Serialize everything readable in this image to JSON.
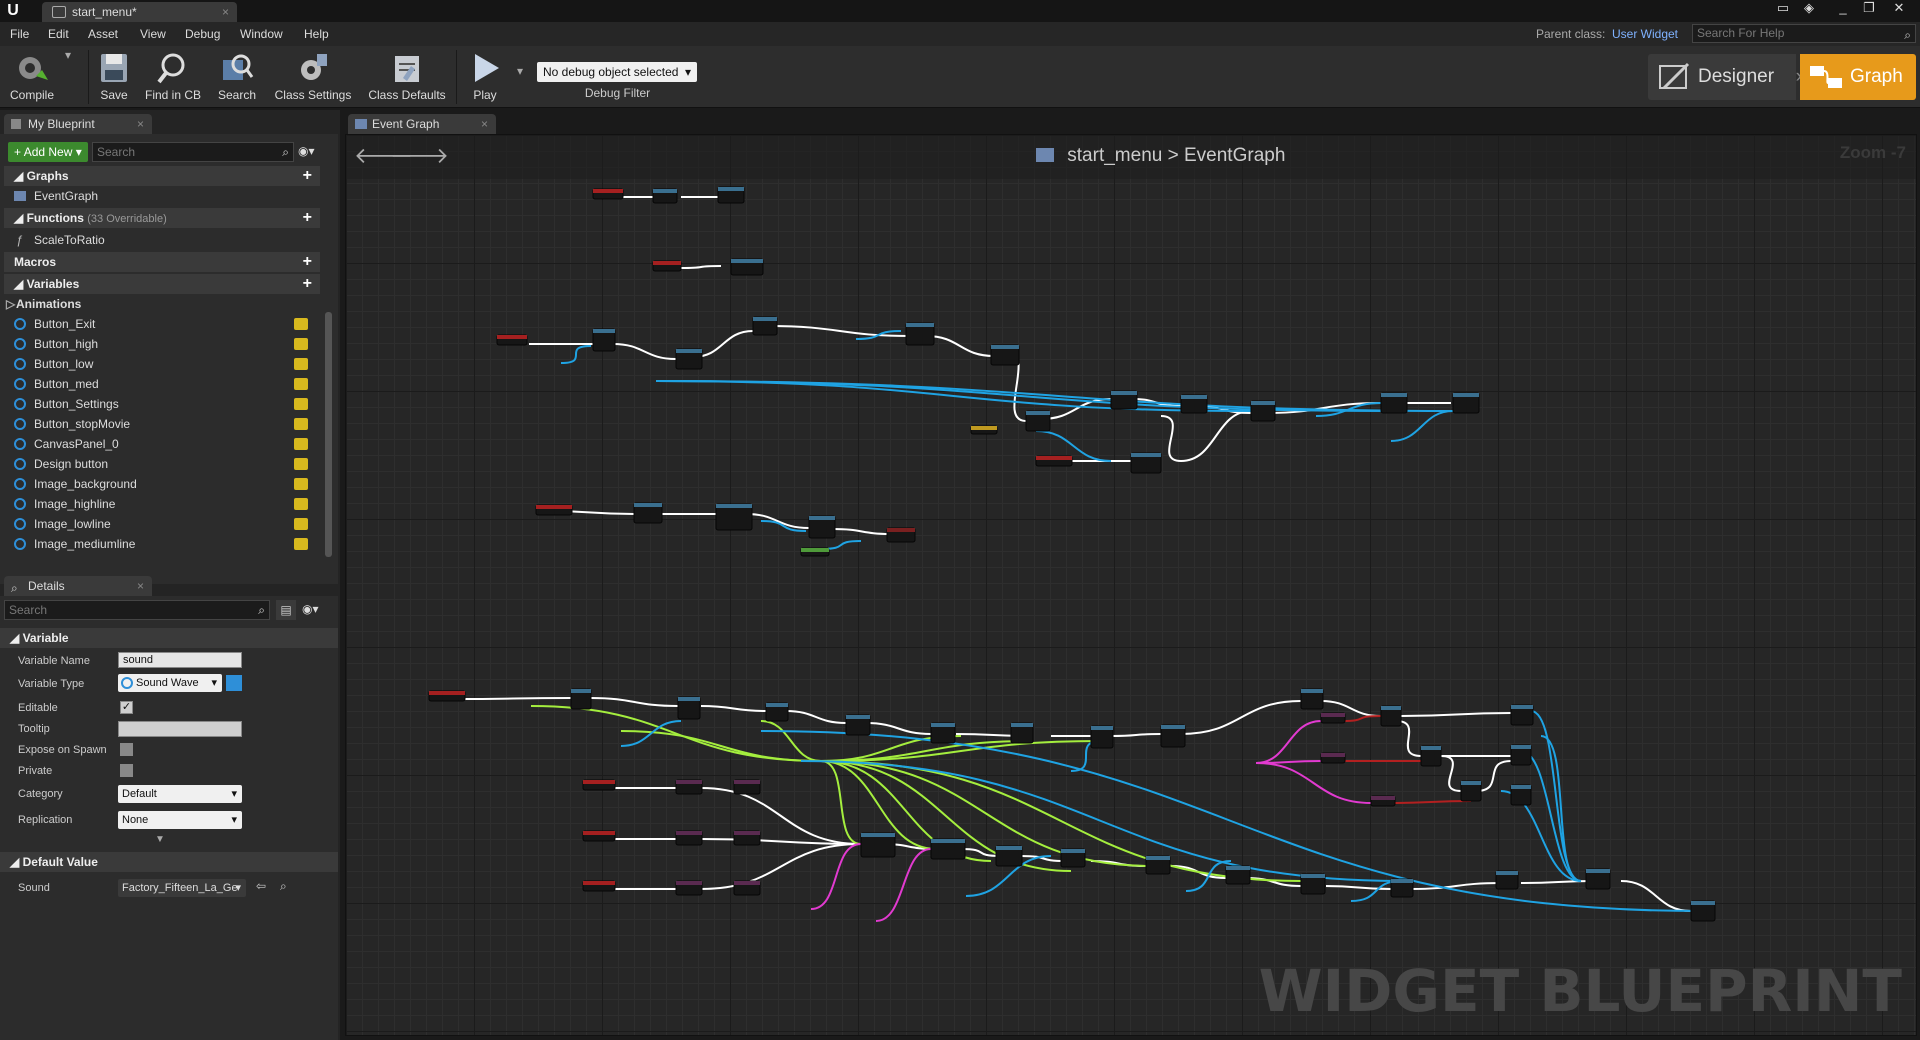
{
  "titlebar": {
    "tab_title": "start_menu*",
    "controls": [
      "_",
      "❐",
      "✕"
    ]
  },
  "menubar": {
    "items": [
      "File",
      "Edit",
      "Asset",
      "View",
      "Debug",
      "Window",
      "Help"
    ],
    "parent_class_label": "Parent class:",
    "parent_class_value": "User Widget",
    "help_search_placeholder": "Search For Help"
  },
  "toolbar": {
    "compile": "Compile",
    "save": "Save",
    "find_in_cb": "Find in CB",
    "search": "Search",
    "class_settings": "Class Settings",
    "class_defaults": "Class Defaults",
    "play": "Play",
    "debug_object": "No debug object selected",
    "debug_filter": "Debug Filter",
    "designer": "Designer",
    "graph": "Graph"
  },
  "my_blueprint": {
    "tab": "My Blueprint",
    "add_new": "Add New",
    "search_placeholder": "Search",
    "sections": {
      "graphs": "Graphs",
      "event_graph": "EventGraph",
      "functions": "Functions",
      "functions_sub": "(33 Overridable)",
      "scale_to_ratio": "ScaleToRatio",
      "macros": "Macros",
      "variables": "Variables",
      "animations": "Animations"
    },
    "variables": [
      "Button_Exit",
      "Button_high",
      "Button_low",
      "Button_med",
      "Button_Settings",
      "Button_stopMovie",
      "CanvasPanel_0",
      "Design button",
      "Image_background",
      "Image_highline",
      "Image_lowline",
      "Image_mediumline"
    ]
  },
  "details": {
    "tab": "Details",
    "search_placeholder": "Search",
    "variable_section": "Variable",
    "fields": {
      "variable_name_label": "Variable Name",
      "variable_name_value": "sound",
      "variable_type_label": "Variable Type",
      "variable_type_value": "Sound Wave",
      "editable_label": "Editable",
      "editable_checked": true,
      "tooltip_label": "Tooltip",
      "tooltip_value": "",
      "expose_label": "Expose on Spawn",
      "private_label": "Private",
      "category_label": "Category",
      "category_value": "Default",
      "replication_label": "Replication",
      "replication_value": "None"
    },
    "default_section": "Default Value",
    "sound_label": "Sound",
    "sound_value": "Factory_Fifteen_La_Ge"
  },
  "graph": {
    "tab": "Event Graph",
    "breadcrumb_root": "start_menu",
    "breadcrumb_sep": ">",
    "breadcrumb_leaf": "EventGraph",
    "zoom": "Zoom -7",
    "watermark": "WIDGET BLUEPRINT",
    "colors": {
      "exec": "#ffffff",
      "object": "#1fa3e3",
      "float": "#a4ee3e",
      "struct": "#e23ad0",
      "red_link": "#b32020"
    }
  }
}
